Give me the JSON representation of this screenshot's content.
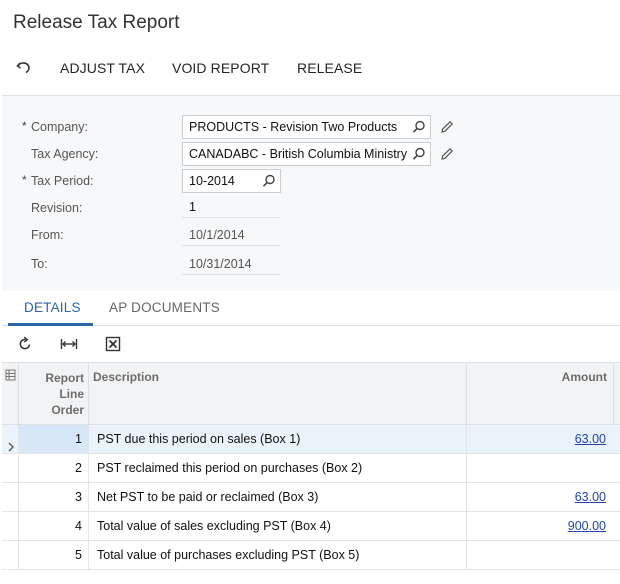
{
  "page": {
    "title": "Release Tax Report"
  },
  "toolbar": {
    "adjust_tax": "ADJUST TAX",
    "void_report": "VOID REPORT",
    "release": "RELEASE"
  },
  "form": {
    "company": {
      "label": "Company:",
      "required": "*",
      "value": "PRODUCTS - Revision Two Products"
    },
    "tax_agency": {
      "label": "Tax Agency:",
      "value": "CANADABC - British Columbia Ministry"
    },
    "tax_period": {
      "label": "Tax Period:",
      "required": "*",
      "value": "10-2014"
    },
    "revision": {
      "label": "Revision:",
      "value": "1"
    },
    "from": {
      "label": "From:",
      "value": "10/1/2014"
    },
    "to": {
      "label": "To:",
      "value": "10/31/2014"
    }
  },
  "tabs": [
    {
      "label": "DETAILS",
      "active": true
    },
    {
      "label": "AP DOCUMENTS",
      "active": false
    }
  ],
  "grid": {
    "columns": {
      "order": [
        "Report",
        "Line",
        "Order"
      ],
      "description": "Description",
      "amount": "Amount"
    },
    "rows": [
      {
        "order": "1",
        "description": "PST due this period on sales (Box 1)",
        "amount": "63.00",
        "selected": true
      },
      {
        "order": "2",
        "description": "PST reclaimed this period on purchases (Box 2)",
        "amount": ""
      },
      {
        "order": "3",
        "description": "Net PST to be paid or reclaimed (Box 3)",
        "amount": "63.00"
      },
      {
        "order": "4",
        "description": "Total value of sales excluding PST (Box 4)",
        "amount": "900.00"
      },
      {
        "order": "5",
        "description": "Total value of purchases excluding PST (Box 5)",
        "amount": ""
      }
    ]
  },
  "icons": {
    "undo": "undo-icon",
    "search": "search-icon",
    "edit": "pencil-icon",
    "refresh": "refresh-icon",
    "fit_columns": "fit-columns-icon",
    "export_excel": "excel-export-icon",
    "column_config": "column-config-icon",
    "row_indicator": "chevron-right-icon"
  },
  "colors": {
    "accent": "#2b66a8",
    "link": "#2344a6",
    "selected_row": "#eaf3fc"
  }
}
